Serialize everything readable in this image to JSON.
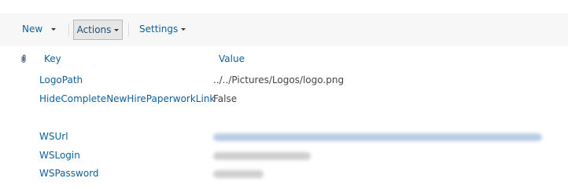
{
  "toolbar": {
    "new_label": "New",
    "actions_label": "Actions",
    "settings_label": "Settings"
  },
  "table": {
    "columns": {
      "attachment_icon": "paperclip-icon",
      "key": "Key",
      "value": "Value"
    },
    "rows": [
      {
        "key": "LogoPath",
        "value": "../../Pictures/Logos/logo.png"
      },
      {
        "key": "HideCompleteNewHirePaperworkLink",
        "value": "False"
      },
      {
        "key": "WSUrl",
        "value": ""
      },
      {
        "key": "WSLogin",
        "value": ""
      },
      {
        "key": "WSPassword",
        "value": ""
      }
    ]
  },
  "colors": {
    "link": "#0f5f9b",
    "text": "#444444",
    "toolbar_bg": "#f7f7f7"
  }
}
